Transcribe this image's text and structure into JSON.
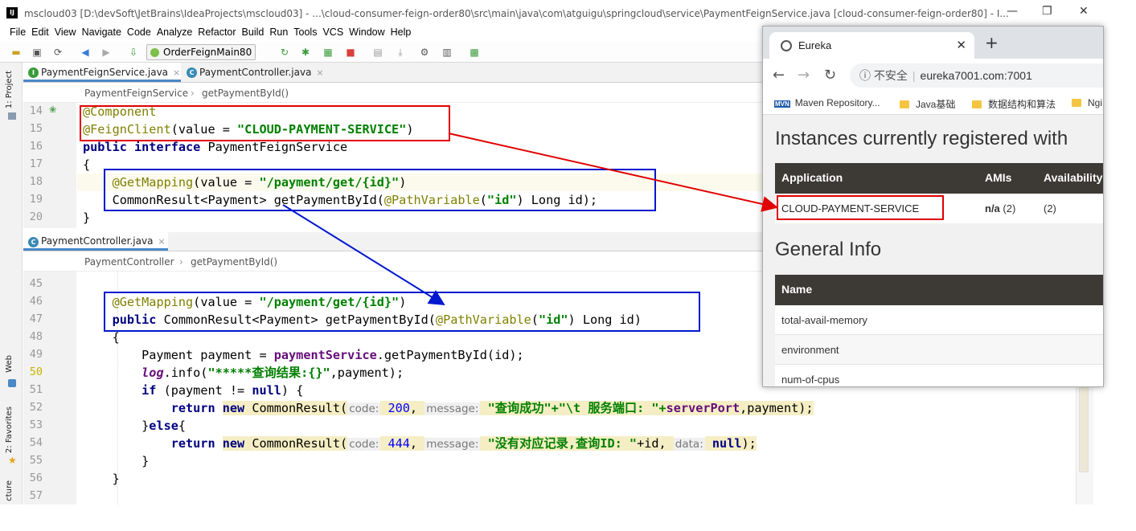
{
  "window": {
    "title": "mscloud03 [D:\\devSoft\\JetBrains\\IdeaProjects\\mscloud03] - ...\\cloud-consumer-feign-order80\\src\\main\\java\\com\\atguigu\\springcloud\\service\\PaymentFeignService.java [cloud-consumer-feign-order80] - I...",
    "app_icon": "IJ",
    "minimize": "—",
    "restore": "❐",
    "close": "✕"
  },
  "menu": [
    "File",
    "Edit",
    "View",
    "Navigate",
    "Code",
    "Analyze",
    "Refactor",
    "Build",
    "Run",
    "Tools",
    "VCS",
    "Window",
    "Help"
  ],
  "toolbar": {
    "run_config": "OrderFeignMain80"
  },
  "sidebar": {
    "project": "1: Project",
    "web": "Web",
    "favorites": "2: Favorites",
    "structure": "cture"
  },
  "top_editor": {
    "tabs": [
      {
        "label": "PaymentFeignService.java",
        "icon": "I",
        "close": "×"
      },
      {
        "label": "PaymentController.java",
        "icon": "C",
        "close": "×"
      }
    ],
    "breadcrumb": [
      "PaymentFeignService",
      "getPaymentById()"
    ],
    "line_numbers": [
      "14",
      "15",
      "16",
      "17",
      "18",
      "19",
      "20"
    ],
    "lines": {
      "l14": "@Component",
      "l15a": "@FeignClient",
      "l15b": "(value = ",
      "l15c": "\"CLOUD-PAYMENT-SERVICE\"",
      "l15d": ")",
      "l16a": "public interface ",
      "l16b": "PaymentFeignService",
      "l17": "{",
      "l18a": "    ",
      "l18b": "@GetMapping",
      "l18c": "(value = ",
      "l18d": "\"/payment/get/{id}\"",
      "l18e": ")",
      "l19a": "    CommonResult<Payment> getPaymentById(",
      "l19b": "@PathVariable",
      "l19c": "(",
      "l19d": "\"id\"",
      "l19e": ") Long id);",
      "l20": "}"
    }
  },
  "bottom_editor": {
    "tabs": [
      {
        "label": "PaymentController.java",
        "icon": "C",
        "close": "×"
      }
    ],
    "breadcrumb": [
      "PaymentController",
      "getPaymentById()"
    ],
    "line_numbers": [
      "45",
      "46",
      "47",
      "48",
      "49",
      "50",
      "51",
      "52",
      "53",
      "54",
      "55",
      "56",
      "57"
    ],
    "lines": {
      "l46a": "    ",
      "l46b": "@GetMapping",
      "l46c": "(value = ",
      "l46d": "\"/payment/get/{id}\"",
      "l46e": ")",
      "l47a": "    ",
      "l47b": "public ",
      "l47c": "CommonResult<Payment> getPaymentById(",
      "l47d": "@PathVariable",
      "l47e": "(",
      "l47f": "\"id\"",
      "l47g": ") Long id)",
      "l48": "    {",
      "l49a": "        Payment payment = ",
      "l49b": "paymentService",
      ".l49c": "",
      "l49c": ".getPaymentById(id);",
      "l50a": "        ",
      "l50b": "log",
      ".l50c": "",
      "l50c": ".info(",
      "l50d": "\"*****查询结果:{}\"",
      "l50e": ",payment);",
      "l51a": "        ",
      "l51b": "if",
      " l51c": "",
      "l51c": " (payment != ",
      "l51d": "null",
      "l51e": ") {",
      "l52a": "            ",
      "l52b": "return ",
      "l52c": "new ",
      "l52d": "CommonResult(",
      "l52e": "code:",
      "l52f": " 200",
      "l52g": ", ",
      "l52h": "message:",
      "l52i": " \"查询成功\"+\"\\t 服务端口: \"+",
      "l52j": "serverPort",
      "l52k": ",payment);",
      "l53a": "        }",
      "l53b": "else",
      "l53c": "{",
      "l54a": "            ",
      "l54b": "return ",
      "l54c": "new ",
      "l54d": "CommonResult(",
      "l54e": "code:",
      "l54f": " 444",
      "l54g": ", ",
      "l54h": "message:",
      "l54i": " \"没有对应记录,查询ID: \"",
      "l54j": "+id, ",
      "l54k": "data:",
      "l54l": " null",
      "l54m": ");",
      "l55": "        }",
      "l56": "    }"
    }
  },
  "browser": {
    "tab_title": "Eureka",
    "tab_close": "✕",
    "new_tab": "+",
    "nav": {
      "back": "←",
      "forward": "→",
      "reload": "↻"
    },
    "security": "ⓘ 不安全",
    "url": "eureka7001.com:7001",
    "bookmarks": [
      {
        "label": "Maven Repository...",
        "icon": "MVN"
      },
      {
        "label": "Java基础"
      },
      {
        "label": "数据结构和算法"
      },
      {
        "label": "Ngi"
      }
    ],
    "heading1": "Instances currently registered with",
    "table1": {
      "headers": [
        "Application",
        "AMIs",
        "Availability"
      ],
      "row": {
        "application": "CLOUD-PAYMENT-SERVICE",
        "amis_bold": "n/a",
        "amis_rest": " (2)",
        "availability": "(2)"
      }
    },
    "heading2": "General Info",
    "table2": {
      "header": "Name",
      "rows": [
        "total-avail-memory",
        "environment",
        "num-of-cpus"
      ]
    }
  },
  "colors": {
    "annotation_box_red": "#e00000",
    "annotation_box_blue": "#0018d0",
    "arrow_red": "#e00000",
    "arrow_blue": "#0018d0"
  }
}
